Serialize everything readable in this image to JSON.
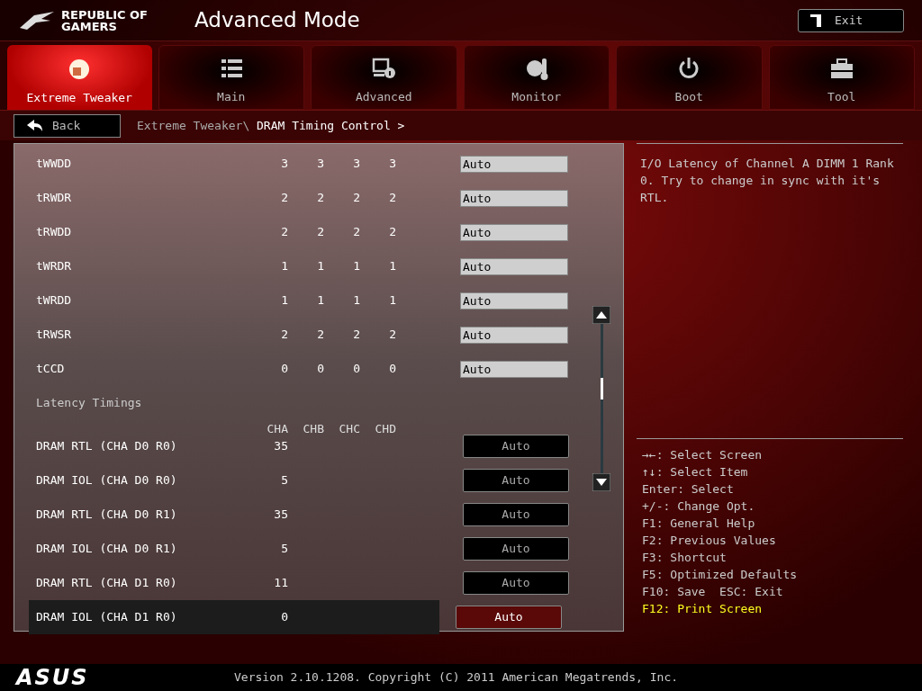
{
  "header": {
    "brand": [
      "REPUBLIC OF",
      "GAMERS"
    ],
    "title": "Advanced Mode",
    "exit_button": "Exit"
  },
  "tabs": [
    {
      "label": "Extreme Tweaker",
      "selected": true
    },
    {
      "label": "Main",
      "selected": false
    },
    {
      "label": "Advanced",
      "selected": false
    },
    {
      "label": "Monitor",
      "selected": false
    },
    {
      "label": "Boot",
      "selected": false
    },
    {
      "label": "Tool",
      "selected": false
    }
  ],
  "back_button": "Back",
  "breadcrumb": {
    "parent": "Extreme Tweaker\\",
    "current": "DRAM Timing Control >"
  },
  "settings": [
    {
      "kind": "timing",
      "name": "tWWDD",
      "values": [
        "3",
        "3",
        "3",
        "3"
      ],
      "setting": "Auto",
      "selected": false
    },
    {
      "kind": "timing",
      "name": "tRWDR",
      "values": [
        "2",
        "2",
        "2",
        "2"
      ],
      "setting": "Auto",
      "selected": false
    },
    {
      "kind": "timing",
      "name": "tRWDD",
      "values": [
        "2",
        "2",
        "2",
        "2"
      ],
      "setting": "Auto",
      "selected": false
    },
    {
      "kind": "timing",
      "name": "tWRDR",
      "values": [
        "1",
        "1",
        "1",
        "1"
      ],
      "setting": "Auto",
      "selected": false
    },
    {
      "kind": "timing",
      "name": "tWRDD",
      "values": [
        "1",
        "1",
        "1",
        "1"
      ],
      "setting": "Auto",
      "selected": false
    },
    {
      "kind": "timing",
      "name": "tRWSR",
      "values": [
        "2",
        "2",
        "2",
        "2"
      ],
      "setting": "Auto",
      "selected": false
    },
    {
      "kind": "timing",
      "name": "tCCD",
      "values": [
        "0",
        "0",
        "0",
        "0"
      ],
      "setting": "Auto",
      "selected": false
    },
    {
      "kind": "heading",
      "name": "Latency Timings"
    },
    {
      "kind": "columns",
      "values": [
        "CHA",
        "CHB",
        "CHC",
        "CHD"
      ]
    },
    {
      "kind": "latency",
      "name": "DRAM RTL (CHA D0 R0)",
      "values": [
        "35"
      ],
      "setting": "Auto",
      "selected": false
    },
    {
      "kind": "latency",
      "name": "DRAM IOL (CHA D0 R0)",
      "values": [
        "5"
      ],
      "setting": "Auto",
      "selected": false
    },
    {
      "kind": "latency",
      "name": "DRAM RTL (CHA D0 R1)",
      "values": [
        "35"
      ],
      "setting": "Auto",
      "selected": false
    },
    {
      "kind": "latency",
      "name": "DRAM IOL (CHA D0 R1)",
      "values": [
        "5"
      ],
      "setting": "Auto",
      "selected": false
    },
    {
      "kind": "latency",
      "name": "DRAM RTL (CHA D1 R0)",
      "values": [
        "11"
      ],
      "setting": "Auto",
      "selected": false
    },
    {
      "kind": "latency",
      "name": "DRAM IOL (CHA D1 R0)",
      "values": [
        "0"
      ],
      "setting": "Auto",
      "selected": true
    }
  ],
  "help_text": "I/O Latency of Channel A DIMM 1 Rank 0. Try to change in sync with it's RTL.",
  "key_help": [
    {
      "text": "→←: Select Screen",
      "highlight": false
    },
    {
      "text": "↑↓: Select Item",
      "highlight": false
    },
    {
      "text": "Enter: Select",
      "highlight": false
    },
    {
      "text": "+/-: Change Opt.",
      "highlight": false
    },
    {
      "text": "F1: General Help",
      "highlight": false
    },
    {
      "text": "F2: Previous Values",
      "highlight": false
    },
    {
      "text": "F3: Shortcut",
      "highlight": false
    },
    {
      "text": "F5: Optimized Defaults",
      "highlight": false
    },
    {
      "text": "F10: Save  ESC: Exit",
      "highlight": false
    },
    {
      "text": "F12: Print Screen",
      "highlight": true
    }
  ],
  "footer": {
    "logo": "ASUS",
    "version": "Version 2.10.1208. Copyright (C) 2011 American Megatrends, Inc."
  }
}
